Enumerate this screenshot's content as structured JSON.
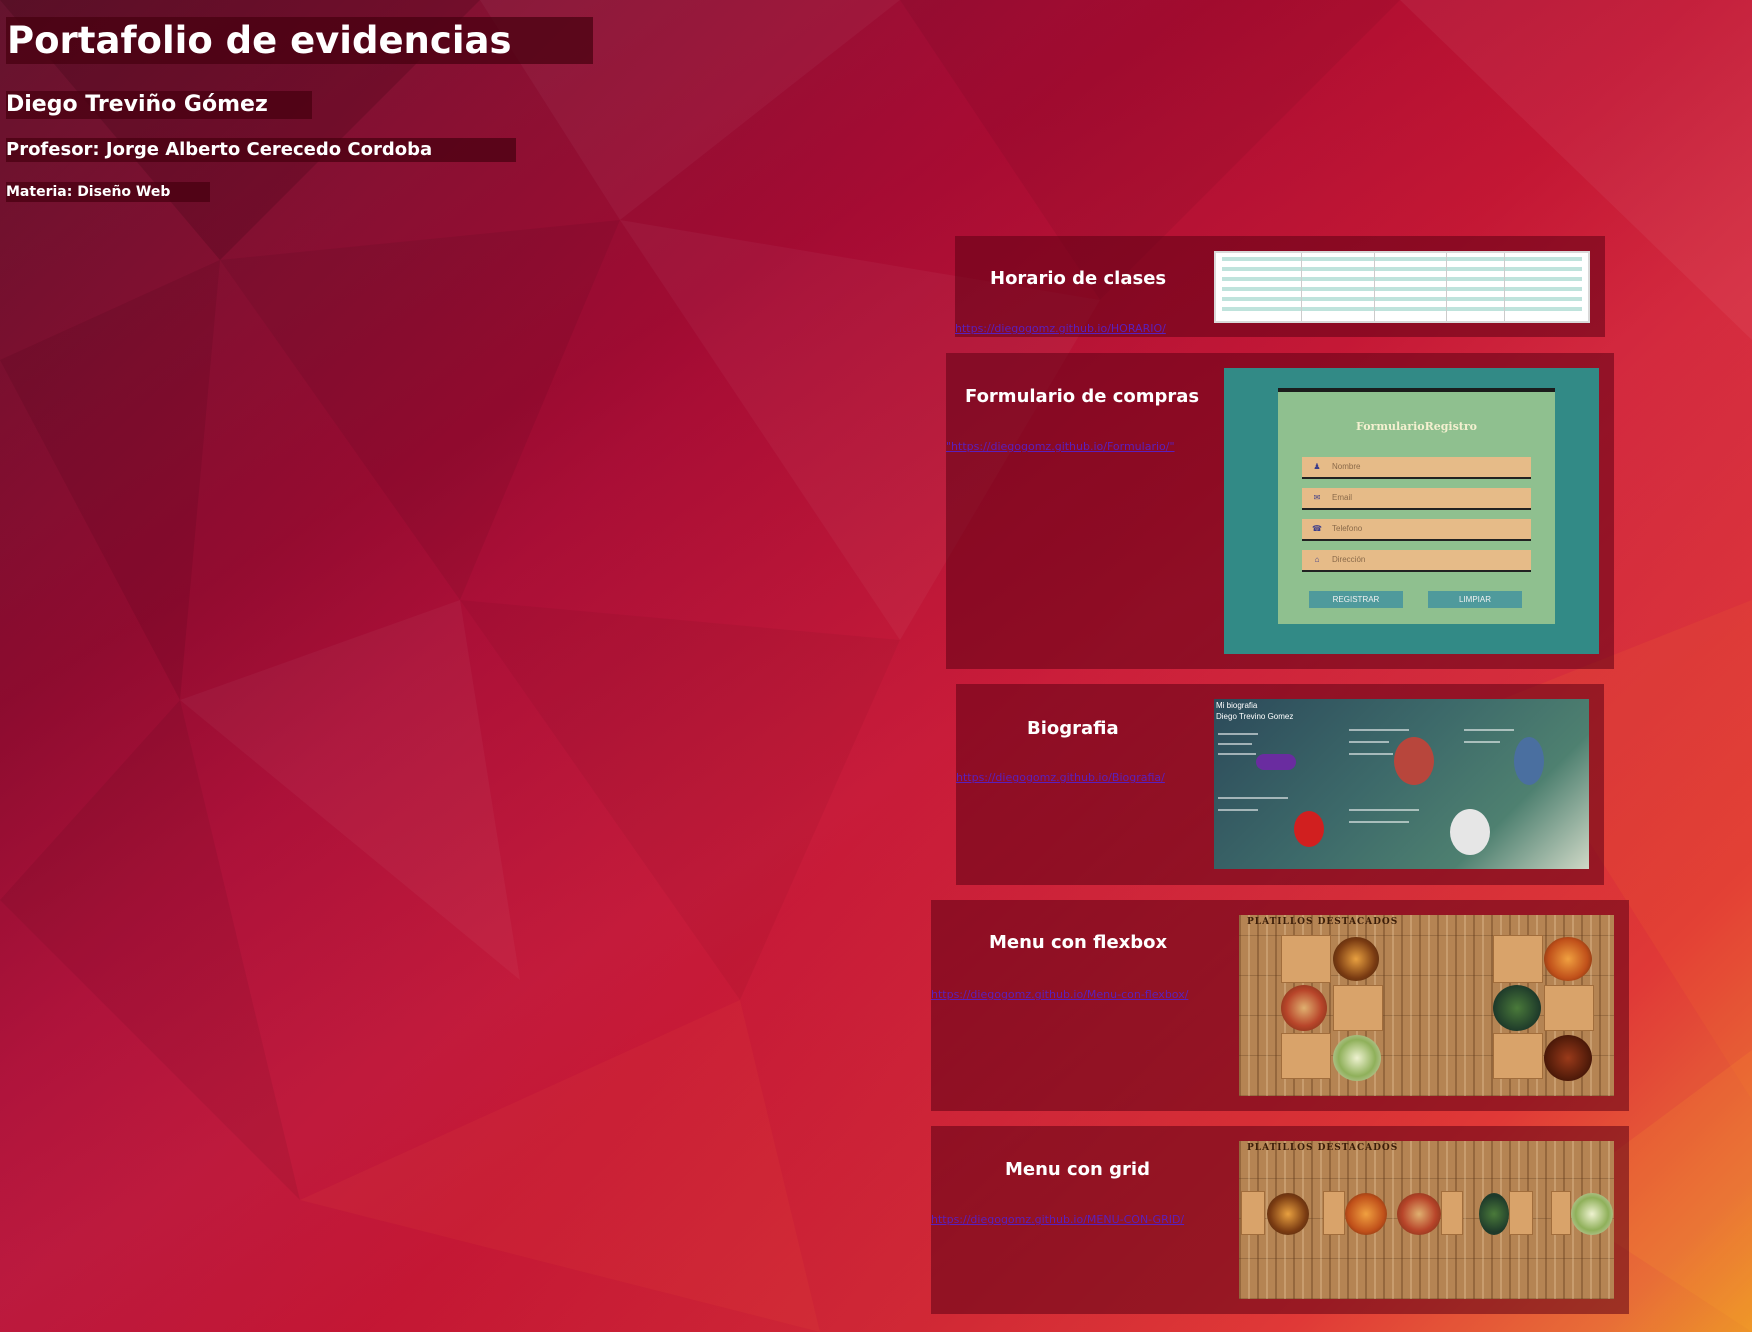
{
  "header": {
    "title": "Portafolio de evidencias",
    "student": "Diego Treviño Gómez",
    "professor": "Profesor: Jorge Alberto Cerecedo Cordoba",
    "subject": "Materia: Diseño Web"
  },
  "cards": [
    {
      "title": "Horario de clases",
      "link": "https://diegogomz.github.io/HORARIO/"
    },
    {
      "title": "Formulario de compras",
      "link": "\"https://diegogomz.github.io/Formulario/\"",
      "preview": {
        "heading": "FormularioRegistro",
        "fields": [
          "Nombre",
          "Email",
          "Telefono",
          "Dirección"
        ],
        "buttons": [
          "REGISTRAR",
          "LIMPIAR"
        ]
      }
    },
    {
      "title": "Biografia",
      "link": "https://diegogomz.github.io/Biografia/",
      "preview": {
        "line1": "Mi biografia",
        "line2": "Diego Trevino Gomez"
      }
    },
    {
      "title": "Menu con flexbox",
      "link": "https://diegogomz.github.io/Menu-con-flexbox/",
      "preview": {
        "heading": "PLATILLOS DESTACADOS"
      }
    },
    {
      "title": "Menu con grid",
      "link": "https://diegogomz.github.io/MENU-CON-GRID/",
      "preview": {
        "heading": "PLATILLOS DESTACADOS"
      }
    }
  ],
  "colors": {
    "background_start": "#5e0a25",
    "background_end": "#fa9c2a",
    "link": "#5a1fbd"
  }
}
